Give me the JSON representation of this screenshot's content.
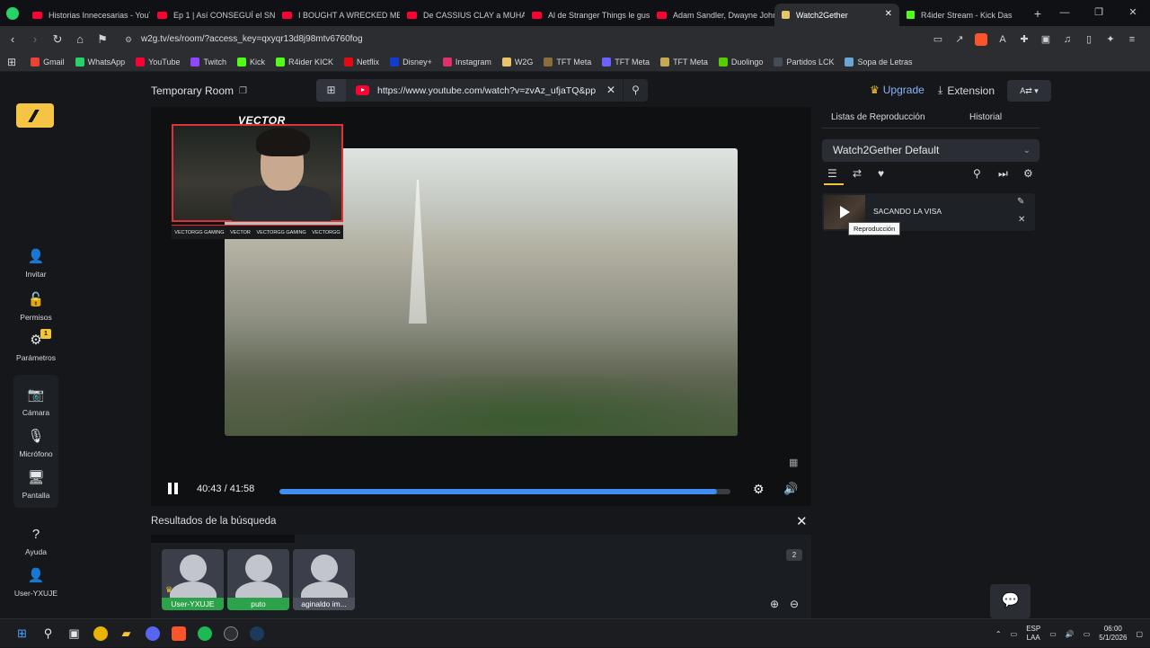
{
  "browser": {
    "tabs": [
      {
        "label": "Historias Innecesarias - YouT",
        "fav": "youtube"
      },
      {
        "label": "Ep 1 | Así CONSEGUÍ el SNIP",
        "fav": "youtube"
      },
      {
        "label": "I BOUGHT A WRECKED MER",
        "fav": "youtube"
      },
      {
        "label": "De CASSIUS CLAY a MUHAM",
        "fav": "youtube"
      },
      {
        "label": "Al de Stranger Things le gust",
        "fav": "youtube"
      },
      {
        "label": "Adam Sandler, Dwayne John",
        "fav": "youtube"
      },
      {
        "label": "Watch2Gether",
        "fav": "w2g"
      },
      {
        "label": "R4ider Stream - Kick Das",
        "fav": "kick"
      }
    ],
    "url": "w2g.tv/es/room/?access_key=qxyqr13d8j98mtv6760fog",
    "bookmarks": [
      {
        "label": "Gmail",
        "color": "#ea4335"
      },
      {
        "label": "WhatsApp",
        "color": "#25d366"
      },
      {
        "label": "YouTube",
        "color": "#ff0033"
      },
      {
        "label": "Twitch",
        "color": "#9146ff"
      },
      {
        "label": "Kick",
        "color": "#53fc18"
      },
      {
        "label": "R4ider KICK",
        "color": "#53fc18"
      },
      {
        "label": "Netflix",
        "color": "#e50914"
      },
      {
        "label": "Disney+",
        "color": "#113ccf"
      },
      {
        "label": "Instagram",
        "color": "#e1306c"
      },
      {
        "label": "W2G",
        "color": "#e9c46a"
      },
      {
        "label": "TFT Meta",
        "color": "#8a6d3b"
      },
      {
        "label": "TFT Meta",
        "color": "#6c63ff"
      },
      {
        "label": "TFT Meta",
        "color": "#c8a951"
      },
      {
        "label": "Duolingo",
        "color": "#58cc02"
      },
      {
        "label": "Partidos LCK",
        "color": "#444c56"
      },
      {
        "label": "Sopa de Letras",
        "color": "#6aa6d6"
      }
    ]
  },
  "sidebar": {
    "items": [
      {
        "label": "Invitar",
        "icon": "add-user-icon",
        "glyph": "👤"
      },
      {
        "label": "Permisos",
        "icon": "lock-icon",
        "glyph": "🔓"
      },
      {
        "label": "Parámetros",
        "icon": "gear-icon",
        "glyph": "⚙",
        "badge": "1"
      },
      {
        "label": "Cámara",
        "icon": "camera-icon",
        "glyph": "📷"
      },
      {
        "label": "Micrófono",
        "icon": "microphone-icon",
        "glyph": "🎙"
      },
      {
        "label": "Pantalla",
        "icon": "screen-icon",
        "glyph": "🖥"
      },
      {
        "label": "Ayuda",
        "icon": "help-icon",
        "glyph": "?"
      },
      {
        "label": "User-YXUJE",
        "icon": "user-icon",
        "glyph": "👤"
      }
    ]
  },
  "room": {
    "title": "Temporary Room",
    "search_value": "https://www.youtube.com/watch?v=zvAz_ufjaTQ&pp",
    "upgrade_label": "Upgrade",
    "extension_label": "Extension"
  },
  "player": {
    "facecam_name": "VECTOR",
    "socials": [
      "VECTORGG GAMING",
      "VECTOR",
      "VECTORGG GAMING",
      "VECTORGG"
    ],
    "time": "40:43 / 41:58",
    "progress": 0.97
  },
  "results": {
    "heading": "Resultados de la búsqueda",
    "count": "2",
    "users": [
      {
        "name": "User-YXUJE",
        "host": true,
        "style": "green"
      },
      {
        "name": "puto",
        "host": false,
        "style": "green"
      },
      {
        "name": "aginaldo im...",
        "host": false,
        "style": "gray"
      }
    ]
  },
  "playlist": {
    "tab_active": "Listas de Reproducción",
    "tab_history": "Historial",
    "selected": "Watch2Gether Default",
    "item_title": "SACANDO LA VISA",
    "tooltip": "Reproducción"
  },
  "taskbar": {
    "lang": "ESP",
    "lang2": "LAA",
    "time": "06:00",
    "date": "5/1/2026"
  }
}
